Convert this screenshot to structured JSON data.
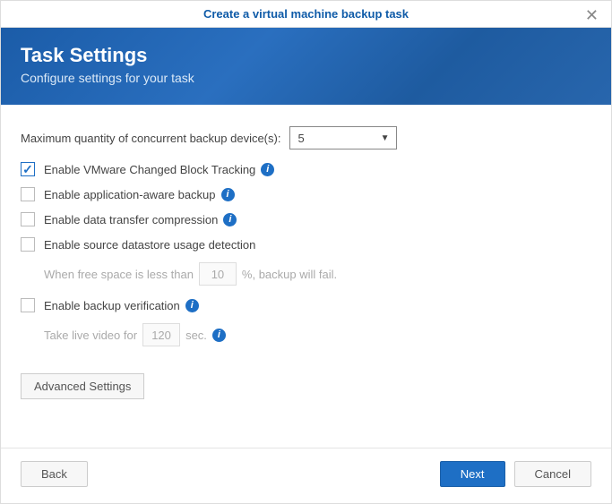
{
  "titlebar": {
    "title": "Create a virtual machine backup task"
  },
  "banner": {
    "title": "Task Settings",
    "subtitle": "Configure settings for your task"
  },
  "maxConcurrent": {
    "label": "Maximum quantity of concurrent backup device(s):",
    "value": "5"
  },
  "options": {
    "cbt": {
      "label": "Enable VMware Changed Block Tracking",
      "checked": true,
      "info": true
    },
    "appAware": {
      "label": "Enable application-aware backup",
      "checked": false,
      "info": true
    },
    "compression": {
      "label": "Enable data transfer compression",
      "checked": false,
      "info": true
    },
    "datastore": {
      "label": "Enable source datastore usage detection",
      "checked": false,
      "info": false,
      "sub": {
        "prefix": "When free space is less than",
        "value": "10",
        "suffix": "%, backup will fail."
      }
    },
    "verification": {
      "label": "Enable backup verification",
      "checked": false,
      "info": true,
      "sub": {
        "prefix": "Take live video for",
        "value": "120",
        "suffix": "sec.",
        "info": true
      }
    }
  },
  "buttons": {
    "advanced": "Advanced Settings",
    "back": "Back",
    "next": "Next",
    "cancel": "Cancel"
  }
}
